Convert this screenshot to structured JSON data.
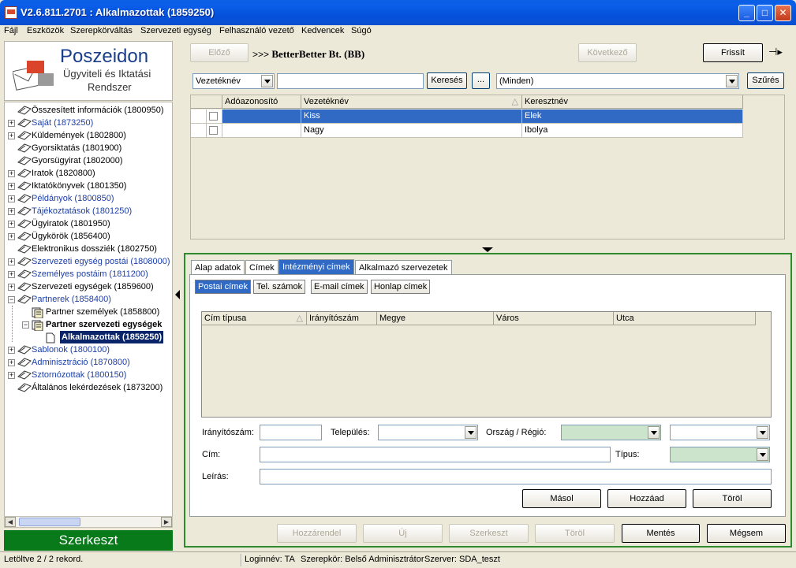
{
  "window": {
    "title": "V2.6.811.2701 : Alkalmazottak (1859250)"
  },
  "menu": [
    "Fájl",
    "Eszközök",
    "Szerepkörváltás",
    "Szervezeti egység",
    "Felhasználó vezető",
    "Kedvencek",
    "Súgó"
  ],
  "logo": {
    "name": "Poszeidon",
    "line2": "Ügyviteli és Iktatási",
    "line3": "Rendszer"
  },
  "tree": [
    {
      "label": "Összesített információk (1800950)",
      "blue": false,
      "expander": false
    },
    {
      "label": "Saját (1873250)",
      "blue": true,
      "expander": true
    },
    {
      "label": "Küldemények (1802800)",
      "blue": false,
      "expander": true
    },
    {
      "label": "Gyorsiktatás (1801900)",
      "blue": false,
      "expander": false
    },
    {
      "label": "Gyorsügyirat (1802000)",
      "blue": false,
      "expander": false
    },
    {
      "label": "Iratok (1820800)",
      "blue": false,
      "expander": true
    },
    {
      "label": "Iktatókönyvek (1801350)",
      "blue": false,
      "expander": true
    },
    {
      "label": "Példányok (1800850)",
      "blue": true,
      "expander": true
    },
    {
      "label": "Tájékoztatások (1801250)",
      "blue": true,
      "expander": true
    },
    {
      "label": "Ügyiratok (1801950)",
      "blue": false,
      "expander": true
    },
    {
      "label": "Ügykörök (1856400)",
      "blue": false,
      "expander": true
    },
    {
      "label": "Elektronikus dossziék (1802750)",
      "blue": false,
      "expander": false
    },
    {
      "label": "Szervezeti egység postái (1808000)",
      "blue": true,
      "expander": true
    },
    {
      "label": "Személyes postáim (1811200)",
      "blue": true,
      "expander": true
    },
    {
      "label": "Szervezeti egységek (1859600)",
      "blue": false,
      "expander": true
    },
    {
      "label": "Partnerek (1858400)",
      "blue": true,
      "expander": true,
      "open": true
    },
    {
      "label": "Partner személyek (1858800)",
      "blue": false,
      "expander": false,
      "level": 1
    },
    {
      "label": "Partner szervezeti egységek",
      "blue": false,
      "expander": true,
      "open": true,
      "level": 1,
      "bold": true
    },
    {
      "label": "Alkalmazottak (1859250)",
      "blue": false,
      "expander": false,
      "level": 2,
      "selected": true
    },
    {
      "label": "Sablonok (1800100)",
      "blue": true,
      "expander": true
    },
    {
      "label": "Adminisztráció (1870800)",
      "blue": true,
      "expander": true
    },
    {
      "label": "Sztornózottak (1800150)",
      "blue": true,
      "expander": true
    },
    {
      "label": "Általános lekérdezések (1873200)",
      "blue": false,
      "expander": false
    }
  ],
  "edit_button": "Szerkeszt",
  "nav": {
    "prev": "Előző",
    "breadcrumb_prefix": ">>>",
    "breadcrumb": "BetterBetter Bt. (BB)",
    "next": "Következő",
    "refresh": "Frissít"
  },
  "filter": {
    "field": "Vezetéknév",
    "value": "",
    "search": "Keresés",
    "more": "...",
    "scope": "(Minden)",
    "apply": "Szűrés"
  },
  "grid": {
    "headers": [
      "Adóazonosító",
      "Vezetéknév",
      "Keresztnév"
    ],
    "rows": [
      {
        "ado": "",
        "vezetek": "Kiss",
        "kereszt": "Elek",
        "selected": true
      },
      {
        "ado": "",
        "vezetek": "Nagy",
        "kereszt": "Ibolya",
        "selected": false
      }
    ]
  },
  "tabs": [
    "Alap adatok",
    "Címek",
    "Intézményi címek",
    "Alkalmazó szervezetek"
  ],
  "subtabs": [
    "Postai címek",
    "Tel. számok",
    "E-mail címek",
    "Honlap címek"
  ],
  "address_grid": {
    "headers": [
      "Cím típusa",
      "Irányítószám",
      "Megye",
      "Város",
      "Utca"
    ]
  },
  "form": {
    "zip_label": "Irányítószám:",
    "city_label": "Település:",
    "country_label": "Ország / Régió:",
    "address_label": "Cím:",
    "type_label": "Típus:",
    "desc_label": "Leírás:"
  },
  "form_buttons": [
    "Másol",
    "Hozzáad",
    "Töröl"
  ],
  "bottom_buttons": {
    "assign": "Hozzárendel",
    "new": "Új",
    "edit": "Szerkeszt",
    "delete": "Töröl",
    "save": "Mentés",
    "cancel": "Mégsem"
  },
  "status": {
    "records": "Letöltve 2 / 2 rekord.",
    "login": "Loginnév: TA",
    "role": "Szerepkör: Belső Adminisztrátor",
    "server": "Szerver: SDA_teszt"
  }
}
